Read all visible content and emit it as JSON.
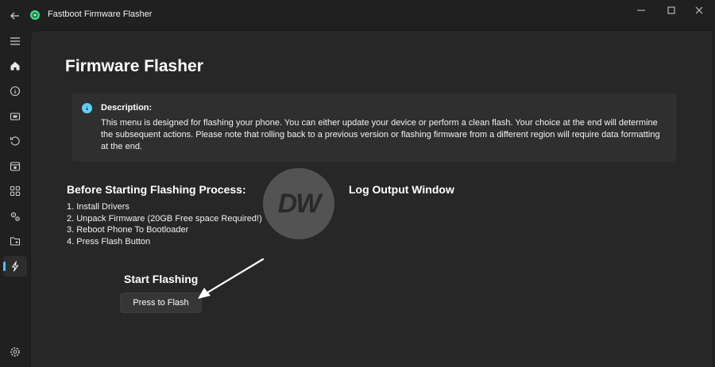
{
  "window": {
    "title": "Fastboot Firmware Flasher",
    "minimize_icon": "minimize-icon",
    "maximize_icon": "maximize-icon",
    "close_icon": "close-icon"
  },
  "sidebar": {
    "items": [
      {
        "icon": "hamburger-menu-icon"
      },
      {
        "icon": "home-icon"
      },
      {
        "icon": "info-circle-icon"
      },
      {
        "icon": "device-icon"
      },
      {
        "icon": "restore-icon"
      },
      {
        "icon": "package-icon"
      },
      {
        "icon": "apps-grid-icon"
      },
      {
        "icon": "gears-icon"
      },
      {
        "icon": "folder-icon"
      },
      {
        "icon": "flash-icon",
        "active": true
      }
    ],
    "settings_icon": "settings-gear-icon"
  },
  "page": {
    "title": "Firmware Flasher",
    "description": {
      "title": "Description:",
      "text": "This menu is designed for flashing your phone. You can either update your device or perform a clean flash. Your choice at the end will determine the subsequent actions. Please note that rolling back to a previous version or flashing firmware from a different region will require data formatting at the end."
    },
    "steps": {
      "title": "Before Starting Flashing Process:",
      "items": [
        "1. Install Drivers",
        "2. Unpack Firmware (20GB Free space Required!)",
        "3. Reboot Phone To Bootloader",
        "4. Press Flash Button"
      ]
    },
    "log": {
      "title": "Log Output Window"
    },
    "flash": {
      "title": "Start Flashing",
      "button_label": "Press to Flash"
    },
    "watermark": "DW"
  },
  "colors": {
    "accent": "#4cc2ff",
    "info": "#60cdff",
    "background": "#202020",
    "content": "#272727"
  }
}
